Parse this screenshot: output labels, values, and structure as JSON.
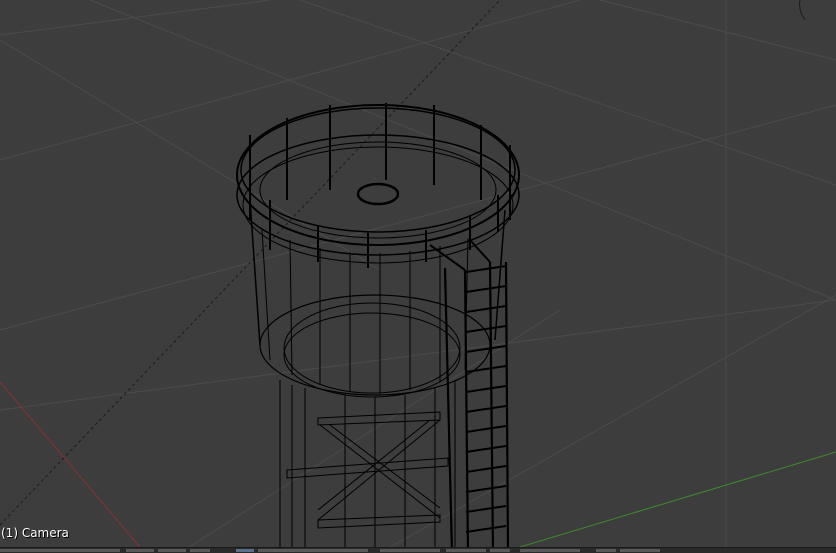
{
  "viewport": {
    "object_label": "(1) Camera"
  },
  "colors": {
    "background": "#3d3d3d",
    "grid": "#4d4d4d",
    "x_axis": "#8a3030",
    "y_axis": "#3f8a2e",
    "wire": "#000000"
  },
  "icons": {
    "corner_widget": "viewport-split-widget"
  }
}
